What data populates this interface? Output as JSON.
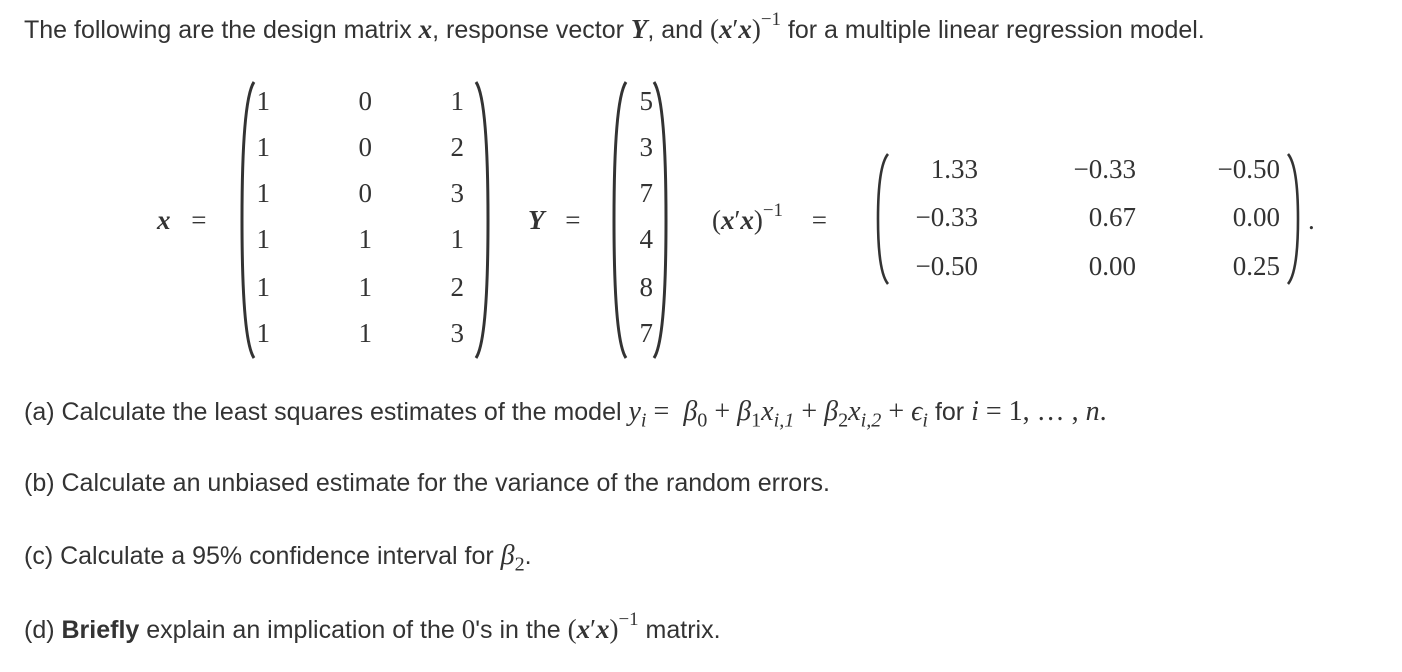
{
  "intro": {
    "prefix": "The following are the design matrix ",
    "x_symbol": "x",
    "middle": ", response vector ",
    "y_symbol": "Y",
    "and": ", and ",
    "inverse_expr": "(x′x)",
    "inverse_exp": "−1",
    "suffix": " for a multiple linear regression model."
  },
  "design_matrix": {
    "label": "x",
    "equals": "=",
    "rows": [
      [
        "1",
        "0",
        "1"
      ],
      [
        "1",
        "0",
        "2"
      ],
      [
        "1",
        "0",
        "3"
      ],
      [
        "1",
        "1",
        "1"
      ],
      [
        "1",
        "1",
        "2"
      ],
      [
        "1",
        "1",
        "3"
      ]
    ]
  },
  "response_vector": {
    "label": "Y",
    "equals": "=",
    "values": [
      "5",
      "3",
      "7",
      "4",
      "8",
      "7"
    ]
  },
  "inverse_matrix": {
    "label_open": "(",
    "label_x1": "x",
    "label_prime": "′",
    "label_x2": "x",
    "label_close": ")",
    "label_exp": "−1",
    "equals": "=",
    "rows": [
      [
        "1.33",
        "−0.33",
        "−0.50"
      ],
      [
        "−0.33",
        "0.67",
        "0.00"
      ],
      [
        "−0.50",
        "0.00",
        "0.25"
      ]
    ],
    "trailing": "."
  },
  "questions": {
    "a": {
      "text": "(a) Calculate the least squares estimates of the model ",
      "y": "y",
      "i": "i",
      "eq": " = ",
      "b0": "β",
      "b0sub": "0",
      "plus1": " + ",
      "b1": "β",
      "b1sub": "1",
      "x1": "x",
      "x1sub": "i,1",
      "plus2": " + ",
      "b2": "β",
      "b2sub": "2",
      "x2": "x",
      "x2sub": "i,2",
      "plus3": " + ",
      "eps": "ϵ",
      "epssub": "i",
      "for": " for ",
      "iv": "i",
      "eq2": " = ",
      "range": "1, … , ",
      "n": "n",
      "end": "."
    },
    "b": {
      "text": "(b) Calculate an unbiased estimate for the variance of the random errors."
    },
    "c": {
      "text": "(c) Calculate a 95% confidence interval for ",
      "beta": "β",
      "sub": "2",
      "end": "."
    },
    "d": {
      "prefix": "(d) ",
      "bold": "Briefly",
      "middle": " explain an implication of the ",
      "zero": "0",
      "middle2": "'s in the ",
      "expr": "(x′x)",
      "exp": "−1",
      "suffix": " matrix."
    }
  }
}
